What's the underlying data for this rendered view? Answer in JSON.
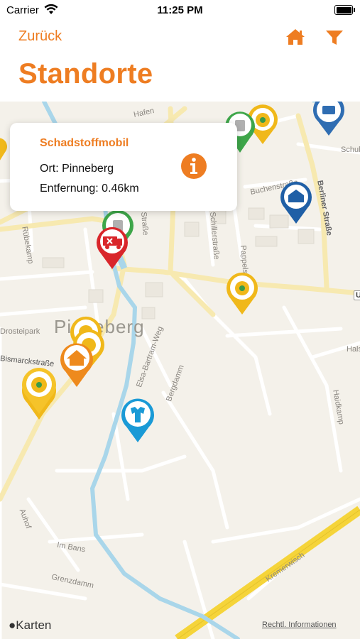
{
  "status": {
    "carrier": "Carrier",
    "time": "11:25 PM"
  },
  "nav": {
    "back_label": "Zurück",
    "title": "Standorte"
  },
  "colors": {
    "accent": "#ee7d22"
  },
  "icons": {
    "home": "home-icon",
    "filter": "filter-icon",
    "info": "info-icon"
  },
  "callout": {
    "title": "Schadstoffmobil",
    "location": "Ort: Pinneberg",
    "distance": "Entfernung: 0.46km"
  },
  "map": {
    "town": "Pinneberg",
    "streets": {
      "s1": "Rübekamp",
      "s2": "Schulstraße",
      "s3": "Buchenstraße",
      "s4": "Berliner Straße",
      "s5": "Schillerstraße",
      "s6": "Pappelstraße",
      "s7": "Drosteipark",
      "s8": "Bismarckstraße",
      "s9": "Elsa-Bartram-Weg",
      "s10": "Bergdamm",
      "s11": "Haidkamp",
      "s12": "Auhof",
      "s13": "Im Bans",
      "s14": "Grenzdamm",
      "s15": "Kremerwisch",
      "s16": "Halstenbeker",
      "s17": "Hafen",
      "s18": "Straße",
      "s19": "U"
    },
    "attribution_brand": "Karten",
    "attribution_link": "Rechtl. Informationen"
  }
}
